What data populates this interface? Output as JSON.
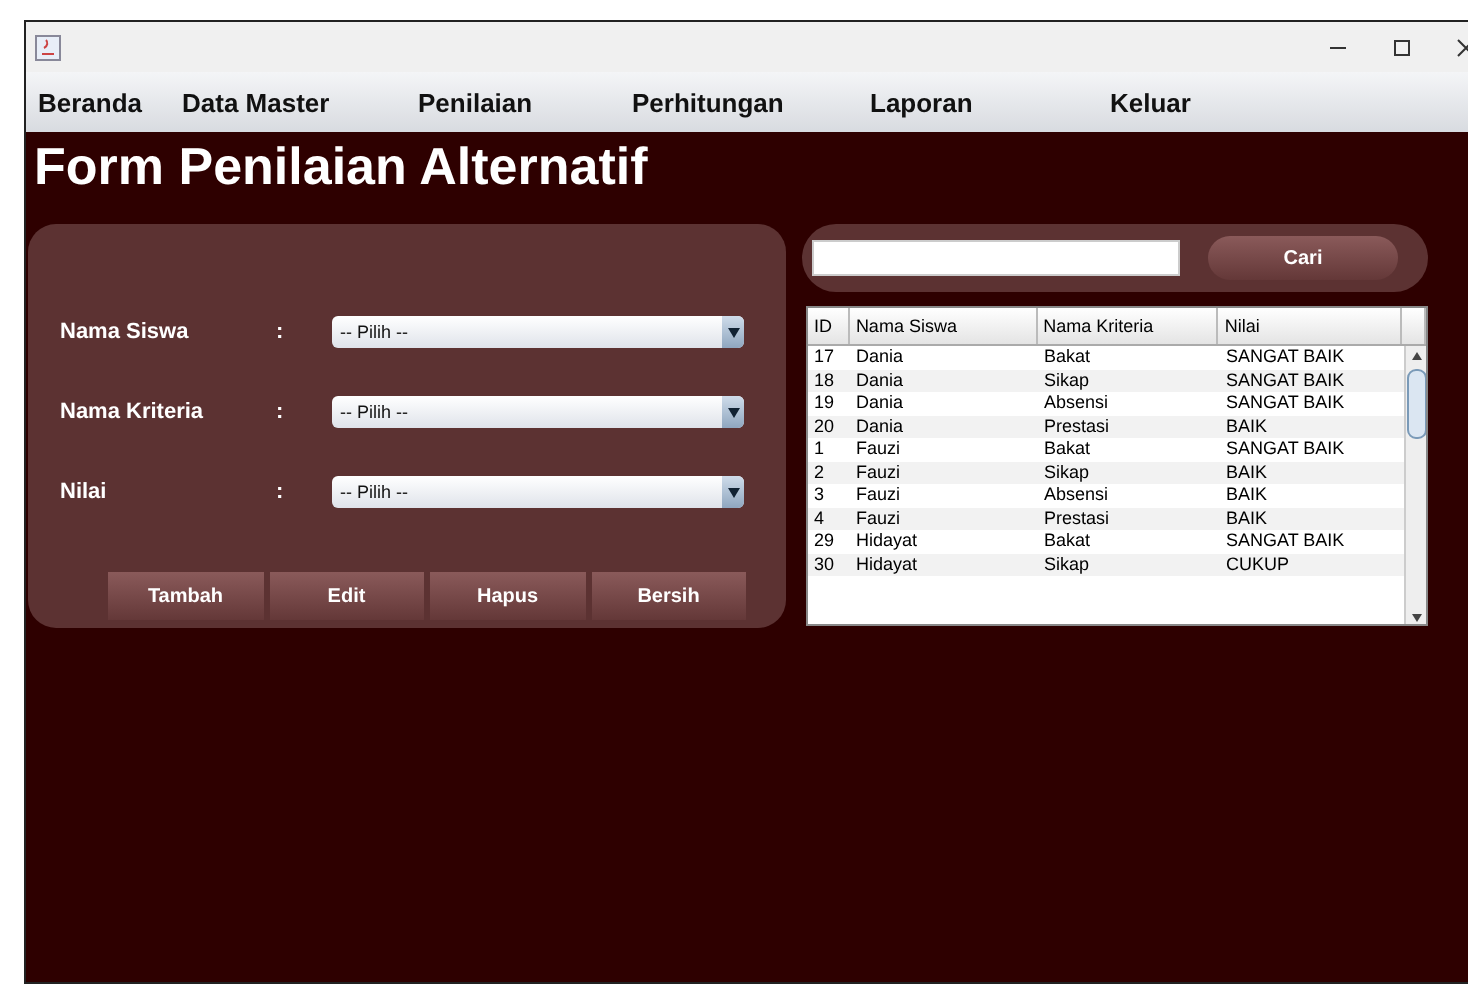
{
  "menu": [
    "Beranda",
    "Data Master",
    "Penilaian",
    "Perhitungan",
    "Laporan",
    "Keluar"
  ],
  "title": "Form Penilaian Alternatif",
  "fields": [
    {
      "label": "Nama Siswa",
      "colon": ":",
      "value": "-- Pilih --"
    },
    {
      "label": "Nama Kriteria",
      "colon": ":",
      "value": "-- Pilih --"
    },
    {
      "label": "Nilai",
      "colon": ":",
      "value": "-- Pilih --"
    }
  ],
  "buttons": [
    "Tambah",
    "Edit",
    "Hapus",
    "Bersih"
  ],
  "search": {
    "button": "Cari"
  },
  "table": {
    "columns": [
      "ID",
      "Nama Siswa",
      "Nama Kriteria",
      "Nilai"
    ],
    "rows": [
      [
        "17",
        "Dania",
        "Bakat",
        "SANGAT BAIK"
      ],
      [
        "18",
        "Dania",
        "Sikap",
        "SANGAT BAIK"
      ],
      [
        "19",
        "Dania",
        "Absensi",
        "SANGAT BAIK"
      ],
      [
        "20",
        "Dania",
        "Prestasi",
        "BAIK"
      ],
      [
        "1",
        "Fauzi",
        "Bakat",
        "SANGAT BAIK"
      ],
      [
        "2",
        "Fauzi",
        "Sikap",
        "BAIK"
      ],
      [
        "3",
        "Fauzi",
        "Absensi",
        "BAIK"
      ],
      [
        "4",
        "Fauzi",
        "Prestasi",
        "BAIK"
      ],
      [
        "29",
        "Hidayat",
        "Bakat",
        "SANGAT BAIK"
      ],
      [
        "30",
        "Hidayat",
        "Sikap",
        "CUKUP"
      ]
    ]
  }
}
